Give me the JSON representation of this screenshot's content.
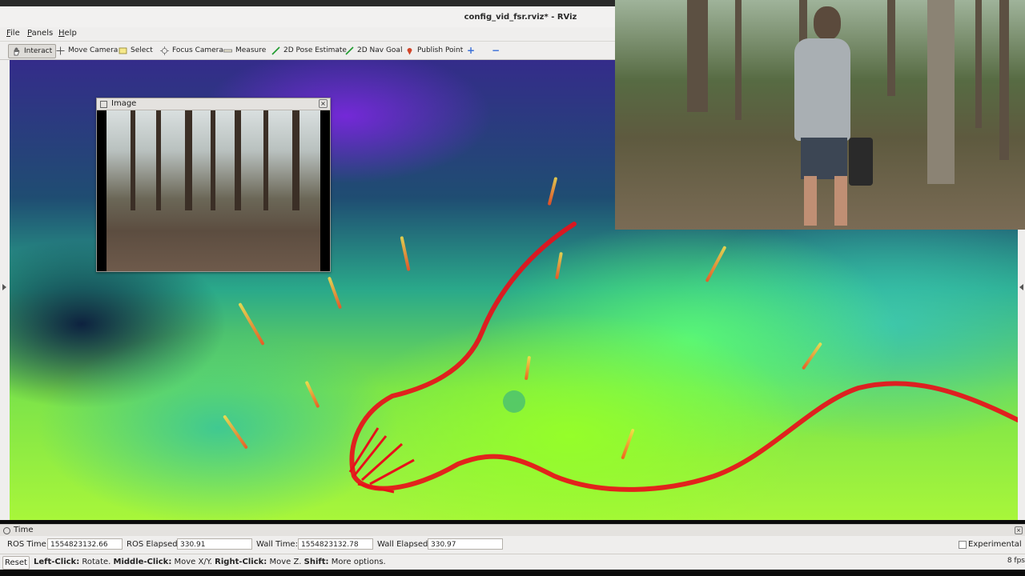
{
  "window": {
    "title": "config_vid_fsr.rviz* - RViz"
  },
  "menu": [
    "File",
    "Panels",
    "Help"
  ],
  "toolbar": {
    "interact": "Interact",
    "move_camera": "Move Camera",
    "select": "Select",
    "focus_camera": "Focus Camera",
    "measure": "Measure",
    "pose_estimate": "2D Pose Estimate",
    "nav_goal": "2D Nav Goal",
    "publish_point": "Publish Point",
    "add_tool": "+",
    "remove_tool": "−"
  },
  "image_panel": {
    "title": "Image",
    "close": "×"
  },
  "time_panel": {
    "title": "Time",
    "close": "×",
    "ros_time_label": "ROS Time:",
    "ros_time": "1554823132.66",
    "ros_elapsed_label": "ROS Elapsed:",
    "ros_elapsed": "330.91",
    "wall_time_label": "Wall Time:",
    "wall_time": "1554823132.78",
    "wall_elapsed_label": "Wall Elapsed:",
    "wall_elapsed": "330.97",
    "experimental": "Experimental"
  },
  "status": {
    "reset": "Reset",
    "left_click": "Left-Click:",
    "left_click_action": " Rotate. ",
    "middle_click": "Middle-Click:",
    "middle_click_action": " Move X/Y. ",
    "right_click": "Right-Click:",
    "right_click_action": " Move Z. ",
    "shift": "Shift:",
    "shift_action": " More options.",
    "fps": "8 fps"
  },
  "colors": {
    "trajectory": "#e8101a",
    "panel_bg": "#efeeed"
  }
}
